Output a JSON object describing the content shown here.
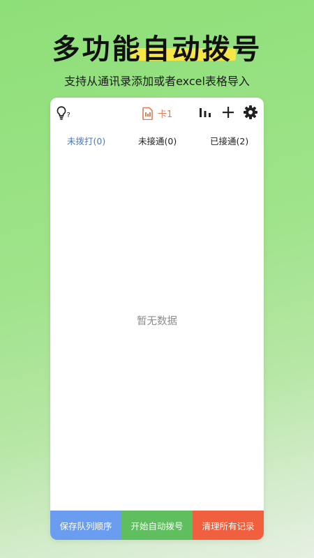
{
  "banner": {
    "title": "多功能自动拨号",
    "subtitle": "支持从通讯录添加或者excel表格导入"
  },
  "toolbar": {
    "help_mark": "?",
    "sim_label": "卡1",
    "icons": [
      "lightbulb-help-icon",
      "sim-card-icon",
      "bar-chart-icon",
      "plus-icon",
      "gear-icon"
    ]
  },
  "tabs": [
    {
      "label": "未拨打(0)",
      "active": true
    },
    {
      "label": "未接通(0)",
      "active": false
    },
    {
      "label": "已接通(2)",
      "active": false
    }
  ],
  "empty_state": "暂无数据",
  "actions": {
    "save_order": "保存队列顺序",
    "start_dialing": "开始自动拨号",
    "clear_records": "清理所有记录"
  },
  "colors": {
    "accent_blue": "#4a79c4",
    "sim_orange": "#e07a55",
    "btn_blue": "#6a9cf0",
    "btn_green": "#5fbf5f",
    "btn_red": "#f0603e",
    "highlight_yellow": "#f6e547"
  }
}
